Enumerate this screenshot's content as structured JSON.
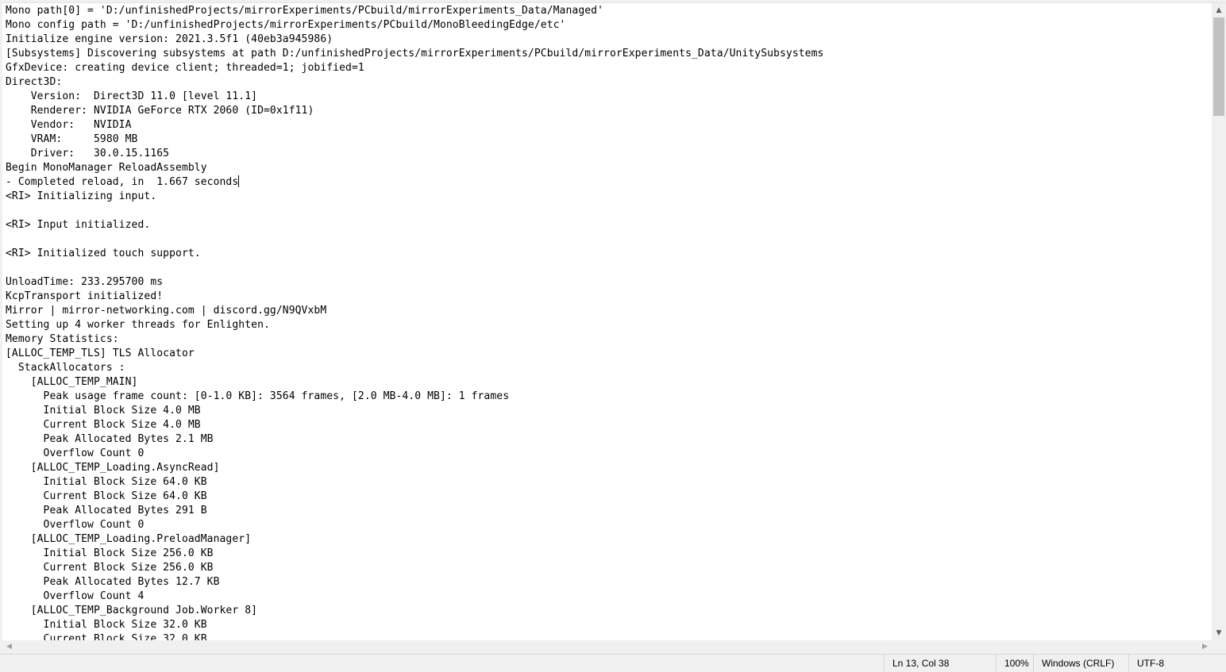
{
  "editor": {
    "lines": [
      "Mono path[0] = 'D:/unfinishedProjects/mirrorExperiments/PCbuild/mirrorExperiments_Data/Managed'",
      "Mono config path = 'D:/unfinishedProjects/mirrorExperiments/PCbuild/MonoBleedingEdge/etc'",
      "Initialize engine version: 2021.3.5f1 (40eb3a945986)",
      "[Subsystems] Discovering subsystems at path D:/unfinishedProjects/mirrorExperiments/PCbuild/mirrorExperiments_Data/UnitySubsystems",
      "GfxDevice: creating device client; threaded=1; jobified=1",
      "Direct3D:",
      "    Version:  Direct3D 11.0 [level 11.1]",
      "    Renderer: NVIDIA GeForce RTX 2060 (ID=0x1f11)",
      "    Vendor:   NVIDIA",
      "    VRAM:     5980 MB",
      "    Driver:   30.0.15.1165",
      "Begin MonoManager ReloadAssembly",
      "- Completed reload, in  1.667 seconds",
      "<RI> Initializing input.",
      "",
      "<RI> Input initialized.",
      "",
      "<RI> Initialized touch support.",
      "",
      "UnloadTime: 233.295700 ms",
      "KcpTransport initialized!",
      "Mirror | mirror-networking.com | discord.gg/N9QVxbM",
      "Setting up 4 worker threads for Enlighten.",
      "Memory Statistics:",
      "[ALLOC_TEMP_TLS] TLS Allocator",
      "  StackAllocators :",
      "    [ALLOC_TEMP_MAIN]",
      "      Peak usage frame count: [0-1.0 KB]: 3564 frames, [2.0 MB-4.0 MB]: 1 frames",
      "      Initial Block Size 4.0 MB",
      "      Current Block Size 4.0 MB",
      "      Peak Allocated Bytes 2.1 MB",
      "      Overflow Count 0",
      "    [ALLOC_TEMP_Loading.AsyncRead]",
      "      Initial Block Size 64.0 KB",
      "      Current Block Size 64.0 KB",
      "      Peak Allocated Bytes 291 B",
      "      Overflow Count 0",
      "    [ALLOC_TEMP_Loading.PreloadManager]",
      "      Initial Block Size 256.0 KB",
      "      Current Block Size 256.0 KB",
      "      Peak Allocated Bytes 12.7 KB",
      "      Overflow Count 4",
      "    [ALLOC_TEMP_Background Job.Worker 8]",
      "      Initial Block Size 32.0 KB",
      "      Current Block Size 32.0 KB"
    ],
    "caret_line": 13,
    "caret_col": 38
  },
  "scrollbars": {
    "vertical_up_icon": "chevron-up-icon",
    "vertical_down_icon": "chevron-down-icon",
    "horizontal_left_icon": "chevron-left-icon",
    "horizontal_right_icon": "chevron-right-icon"
  },
  "status_bar": {
    "position": "Ln 13, Col 38",
    "zoom": "100%",
    "line_ending": "Windows (CRLF)",
    "encoding": "UTF-8"
  },
  "colors": {
    "background": "#ffffff",
    "text": "#000000",
    "chrome": "#f0f0f0",
    "scroll_thumb": "#c1c1c1"
  }
}
